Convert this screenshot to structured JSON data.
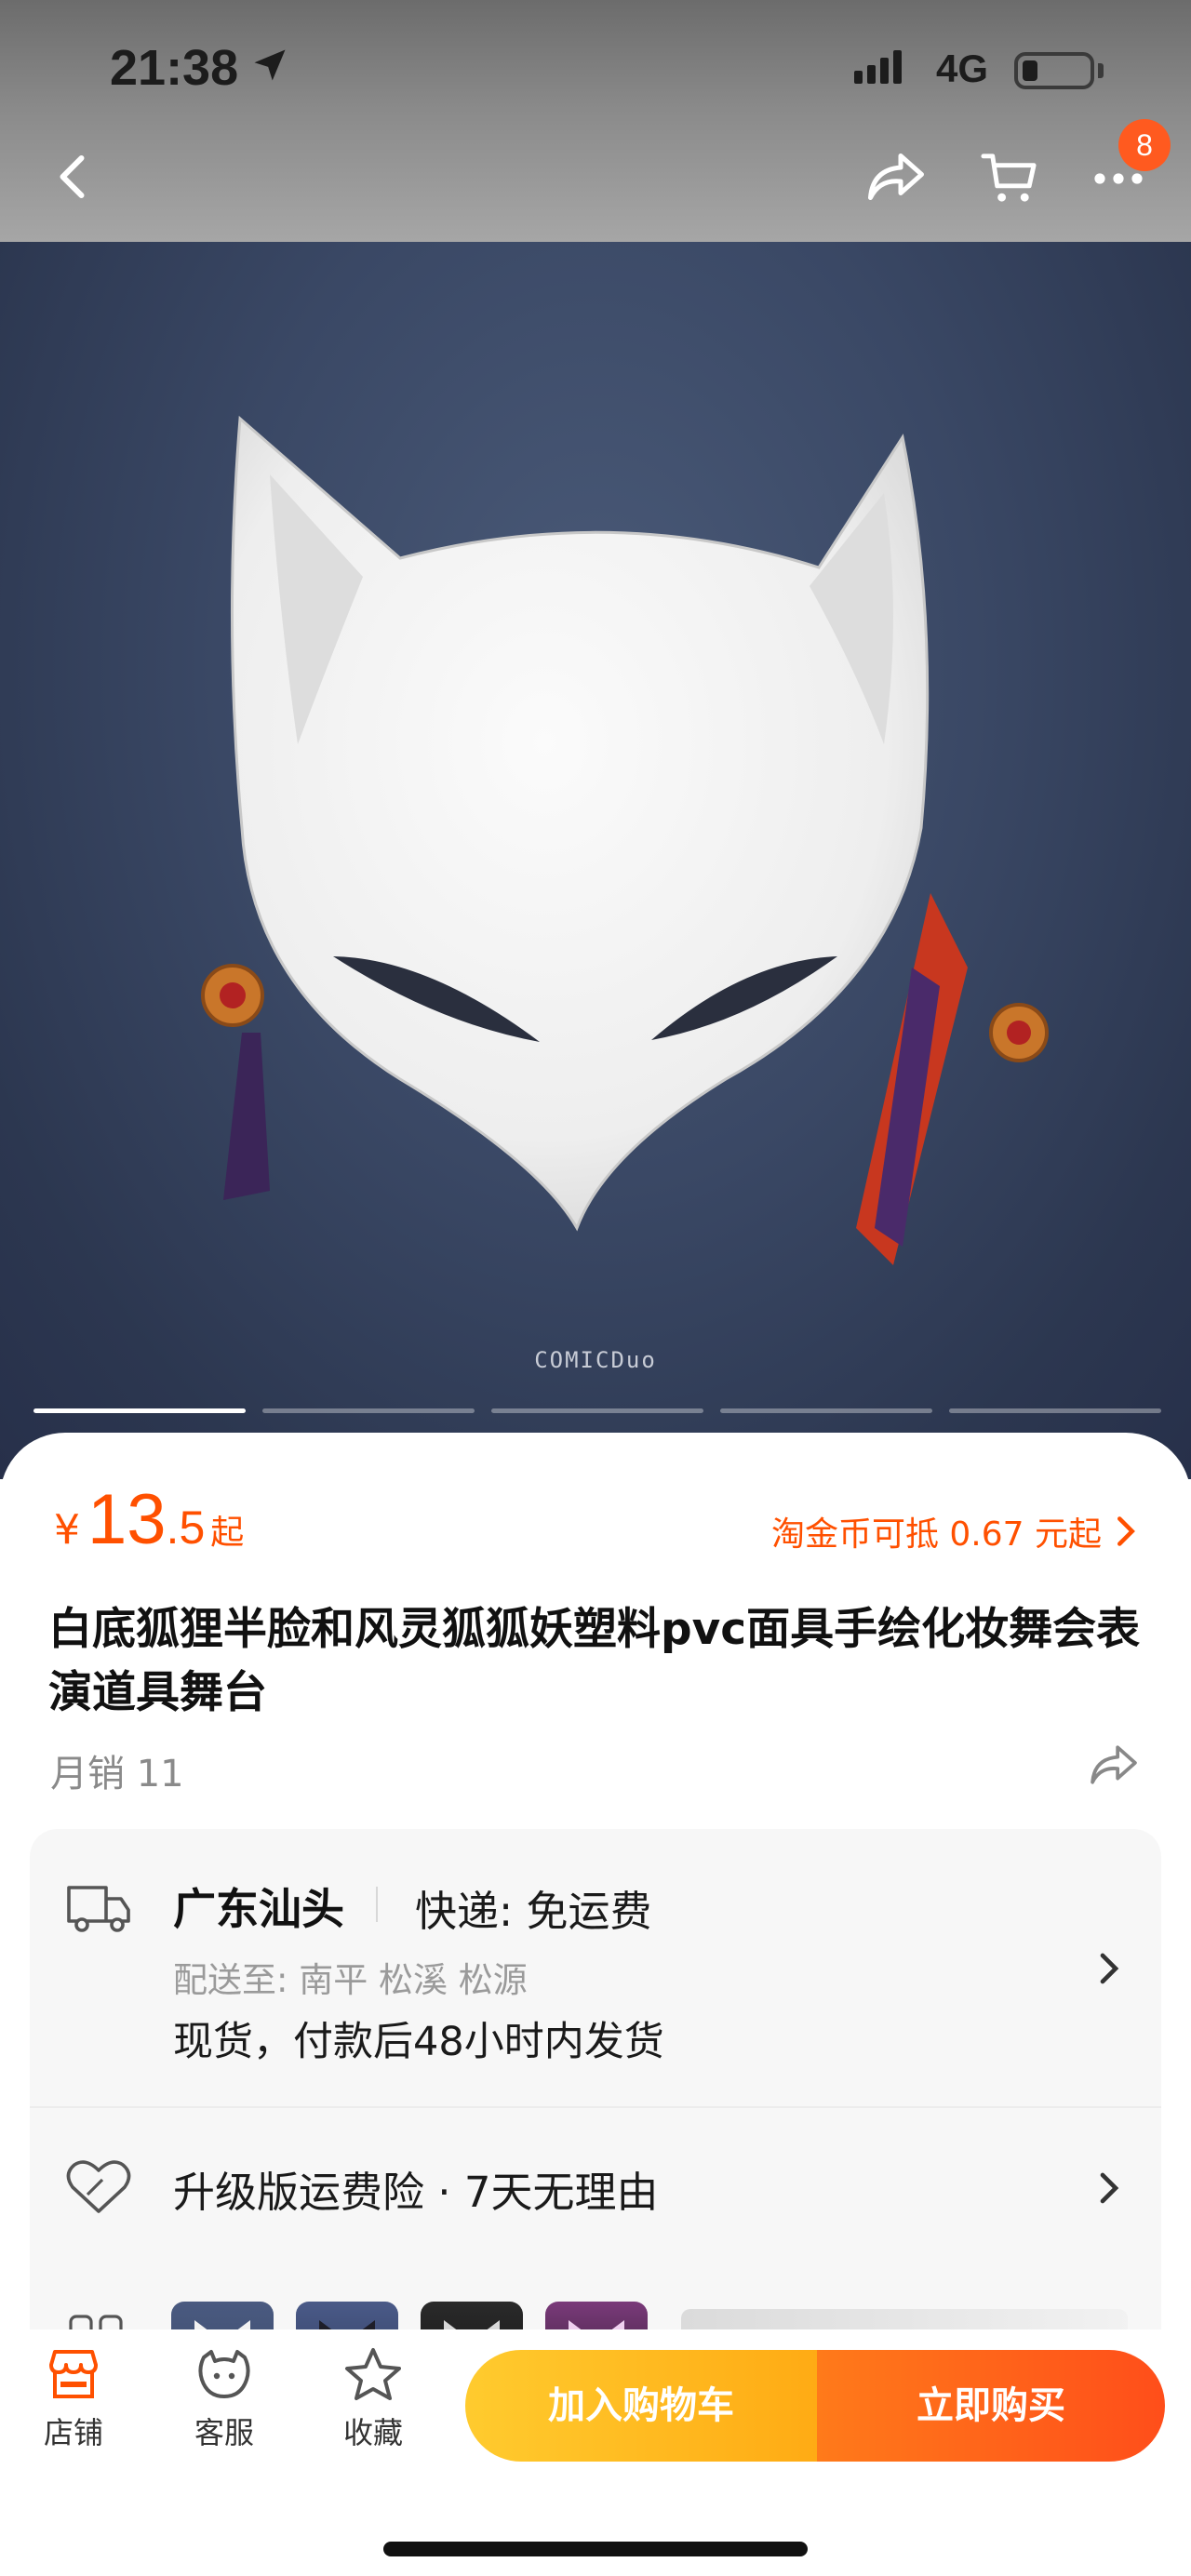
{
  "status_bar": {
    "time": "21:38",
    "network": "4G"
  },
  "nav": {
    "cart_badge": "8"
  },
  "hero": {
    "watermark": "COMICDuo",
    "slide_count": 5,
    "active_slide": 1
  },
  "product": {
    "price_symbol": "¥",
    "price_integer": "13",
    "price_decimal": ".5",
    "price_suffix": "起",
    "coin_offer": "淘金币可抵 0.67 元起",
    "title": "白底狐狸半脸和风灵狐狐妖塑料pvc面具手绘化妆舞会表演道具舞台",
    "sales": "月销 11"
  },
  "shipping": {
    "origin": "广东汕头",
    "method": "快递: 免运费",
    "destination": "配送至: 南平 松溪 松源",
    "note": "现货，付款后48小时内发货"
  },
  "insurance": {
    "text": "升级版运费险 · 7天无理由"
  },
  "toolbar": {
    "store_label": "店铺",
    "service_label": "客服",
    "favorite_label": "收藏",
    "add_to_cart_label": "加入购物车",
    "buy_now_label": "立即购买"
  },
  "colors": {
    "accent": "#ff5000",
    "cart_button": "#ffb31a",
    "buy_button": "#ff5a1a",
    "hero_background": "#3a4865"
  }
}
